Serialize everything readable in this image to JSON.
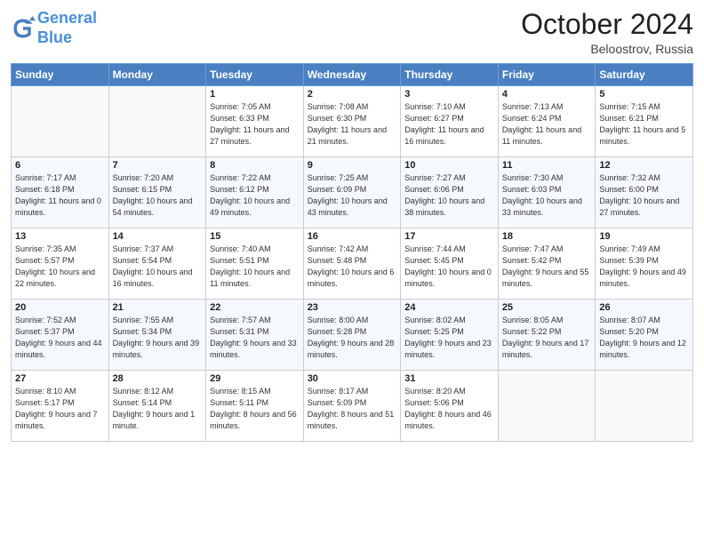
{
  "header": {
    "logo_line1": "General",
    "logo_line2": "Blue",
    "month_year": "October 2024",
    "location": "Beloostrov, Russia"
  },
  "weekdays": [
    "Sunday",
    "Monday",
    "Tuesday",
    "Wednesday",
    "Thursday",
    "Friday",
    "Saturday"
  ],
  "weeks": [
    [
      {
        "day": "",
        "sunrise": "",
        "sunset": "",
        "daylight": ""
      },
      {
        "day": "",
        "sunrise": "",
        "sunset": "",
        "daylight": ""
      },
      {
        "day": "1",
        "sunrise": "Sunrise: 7:05 AM",
        "sunset": "Sunset: 6:33 PM",
        "daylight": "Daylight: 11 hours and 27 minutes."
      },
      {
        "day": "2",
        "sunrise": "Sunrise: 7:08 AM",
        "sunset": "Sunset: 6:30 PM",
        "daylight": "Daylight: 11 hours and 21 minutes."
      },
      {
        "day": "3",
        "sunrise": "Sunrise: 7:10 AM",
        "sunset": "Sunset: 6:27 PM",
        "daylight": "Daylight: 11 hours and 16 minutes."
      },
      {
        "day": "4",
        "sunrise": "Sunrise: 7:13 AM",
        "sunset": "Sunset: 6:24 PM",
        "daylight": "Daylight: 11 hours and 11 minutes."
      },
      {
        "day": "5",
        "sunrise": "Sunrise: 7:15 AM",
        "sunset": "Sunset: 6:21 PM",
        "daylight": "Daylight: 11 hours and 5 minutes."
      }
    ],
    [
      {
        "day": "6",
        "sunrise": "Sunrise: 7:17 AM",
        "sunset": "Sunset: 6:18 PM",
        "daylight": "Daylight: 11 hours and 0 minutes."
      },
      {
        "day": "7",
        "sunrise": "Sunrise: 7:20 AM",
        "sunset": "Sunset: 6:15 PM",
        "daylight": "Daylight: 10 hours and 54 minutes."
      },
      {
        "day": "8",
        "sunrise": "Sunrise: 7:22 AM",
        "sunset": "Sunset: 6:12 PM",
        "daylight": "Daylight: 10 hours and 49 minutes."
      },
      {
        "day": "9",
        "sunrise": "Sunrise: 7:25 AM",
        "sunset": "Sunset: 6:09 PM",
        "daylight": "Daylight: 10 hours and 43 minutes."
      },
      {
        "day": "10",
        "sunrise": "Sunrise: 7:27 AM",
        "sunset": "Sunset: 6:06 PM",
        "daylight": "Daylight: 10 hours and 38 minutes."
      },
      {
        "day": "11",
        "sunrise": "Sunrise: 7:30 AM",
        "sunset": "Sunset: 6:03 PM",
        "daylight": "Daylight: 10 hours and 33 minutes."
      },
      {
        "day": "12",
        "sunrise": "Sunrise: 7:32 AM",
        "sunset": "Sunset: 6:00 PM",
        "daylight": "Daylight: 10 hours and 27 minutes."
      }
    ],
    [
      {
        "day": "13",
        "sunrise": "Sunrise: 7:35 AM",
        "sunset": "Sunset: 5:57 PM",
        "daylight": "Daylight: 10 hours and 22 minutes."
      },
      {
        "day": "14",
        "sunrise": "Sunrise: 7:37 AM",
        "sunset": "Sunset: 5:54 PM",
        "daylight": "Daylight: 10 hours and 16 minutes."
      },
      {
        "day": "15",
        "sunrise": "Sunrise: 7:40 AM",
        "sunset": "Sunset: 5:51 PM",
        "daylight": "Daylight: 10 hours and 11 minutes."
      },
      {
        "day": "16",
        "sunrise": "Sunrise: 7:42 AM",
        "sunset": "Sunset: 5:48 PM",
        "daylight": "Daylight: 10 hours and 6 minutes."
      },
      {
        "day": "17",
        "sunrise": "Sunrise: 7:44 AM",
        "sunset": "Sunset: 5:45 PM",
        "daylight": "Daylight: 10 hours and 0 minutes."
      },
      {
        "day": "18",
        "sunrise": "Sunrise: 7:47 AM",
        "sunset": "Sunset: 5:42 PM",
        "daylight": "Daylight: 9 hours and 55 minutes."
      },
      {
        "day": "19",
        "sunrise": "Sunrise: 7:49 AM",
        "sunset": "Sunset: 5:39 PM",
        "daylight": "Daylight: 9 hours and 49 minutes."
      }
    ],
    [
      {
        "day": "20",
        "sunrise": "Sunrise: 7:52 AM",
        "sunset": "Sunset: 5:37 PM",
        "daylight": "Daylight: 9 hours and 44 minutes."
      },
      {
        "day": "21",
        "sunrise": "Sunrise: 7:55 AM",
        "sunset": "Sunset: 5:34 PM",
        "daylight": "Daylight: 9 hours and 39 minutes."
      },
      {
        "day": "22",
        "sunrise": "Sunrise: 7:57 AM",
        "sunset": "Sunset: 5:31 PM",
        "daylight": "Daylight: 9 hours and 33 minutes."
      },
      {
        "day": "23",
        "sunrise": "Sunrise: 8:00 AM",
        "sunset": "Sunset: 5:28 PM",
        "daylight": "Daylight: 9 hours and 28 minutes."
      },
      {
        "day": "24",
        "sunrise": "Sunrise: 8:02 AM",
        "sunset": "Sunset: 5:25 PM",
        "daylight": "Daylight: 9 hours and 23 minutes."
      },
      {
        "day": "25",
        "sunrise": "Sunrise: 8:05 AM",
        "sunset": "Sunset: 5:22 PM",
        "daylight": "Daylight: 9 hours and 17 minutes."
      },
      {
        "day": "26",
        "sunrise": "Sunrise: 8:07 AM",
        "sunset": "Sunset: 5:20 PM",
        "daylight": "Daylight: 9 hours and 12 minutes."
      }
    ],
    [
      {
        "day": "27",
        "sunrise": "Sunrise: 8:10 AM",
        "sunset": "Sunset: 5:17 PM",
        "daylight": "Daylight: 9 hours and 7 minutes."
      },
      {
        "day": "28",
        "sunrise": "Sunrise: 8:12 AM",
        "sunset": "Sunset: 5:14 PM",
        "daylight": "Daylight: 9 hours and 1 minute."
      },
      {
        "day": "29",
        "sunrise": "Sunrise: 8:15 AM",
        "sunset": "Sunset: 5:11 PM",
        "daylight": "Daylight: 8 hours and 56 minutes."
      },
      {
        "day": "30",
        "sunrise": "Sunrise: 8:17 AM",
        "sunset": "Sunset: 5:09 PM",
        "daylight": "Daylight: 8 hours and 51 minutes."
      },
      {
        "day": "31",
        "sunrise": "Sunrise: 8:20 AM",
        "sunset": "Sunset: 5:06 PM",
        "daylight": "Daylight: 8 hours and 46 minutes."
      },
      {
        "day": "",
        "sunrise": "",
        "sunset": "",
        "daylight": ""
      },
      {
        "day": "",
        "sunrise": "",
        "sunset": "",
        "daylight": ""
      }
    ]
  ]
}
